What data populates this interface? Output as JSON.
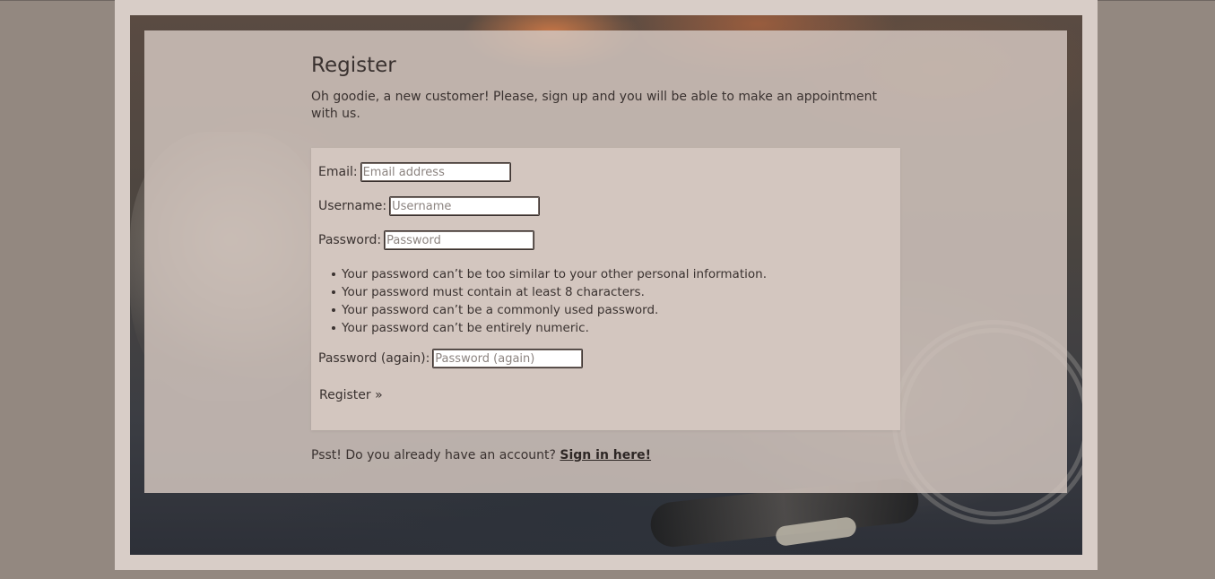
{
  "page": {
    "title": "Register",
    "intro": "Oh goodie, a new customer! Please, sign up and you will be able to make an appointment with us."
  },
  "form": {
    "email": {
      "label": "Email:",
      "placeholder": "Email address",
      "value": ""
    },
    "username": {
      "label": "Username:",
      "placeholder": "Username",
      "value": ""
    },
    "password": {
      "label": "Password:",
      "placeholder": "Password",
      "value": ""
    },
    "password_rules": [
      "Your password can’t be too similar to your other personal information.",
      "Your password must contain at least 8 characters.",
      "Your password can’t be a commonly used password.",
      "Your password can’t be entirely numeric."
    ],
    "password_again": {
      "label": "Password (again):",
      "placeholder": "Password (again)",
      "value": ""
    },
    "submit_label": "Register »"
  },
  "footer": {
    "prompt": "Psst! Do you already have an account? ",
    "signin_link": "Sign in here!"
  },
  "colors": {
    "page_background": "#938880",
    "frame": "#d8cdc7",
    "panel": "#d0c4bd",
    "form_box": "#d3c6bf",
    "text": "#3a3230"
  }
}
